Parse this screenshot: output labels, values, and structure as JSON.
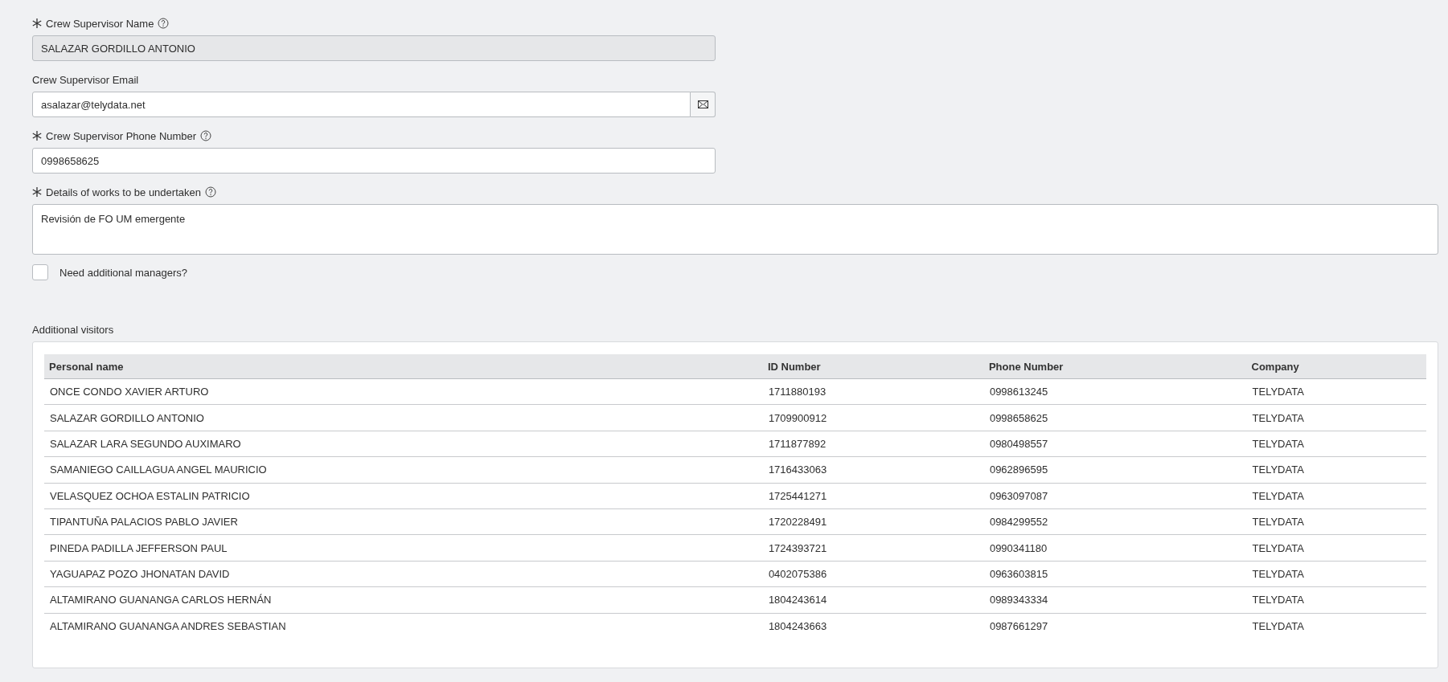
{
  "fields": [
    {
      "kind": "text",
      "label": "Crew Supervisor Name",
      "required": true,
      "help": true,
      "value": "SALAZAR GORDILLO ANTONIO",
      "disabled": true
    },
    {
      "kind": "email",
      "label": "Crew Supervisor Email",
      "required": false,
      "help": false,
      "value": "asalazar@telydata.net",
      "disabled": false
    },
    {
      "kind": "text",
      "label": "Crew Supervisor Phone Number",
      "required": true,
      "help": true,
      "value": "0998658625",
      "disabled": false
    },
    {
      "kind": "textarea",
      "label": "Details of works to be undertaken",
      "required": true,
      "help": true,
      "value": "Revisión de FO UM emergente",
      "disabled": false
    }
  ],
  "checkbox": {
    "label": "Need additional managers?",
    "checked": false
  },
  "visitors": {
    "title": "Additional visitors",
    "columns": [
      "Personal name",
      "ID Number",
      "Phone Number",
      "Company"
    ],
    "rows": [
      [
        "ONCE CONDO XAVIER ARTURO",
        "1711880193",
        "0998613245",
        "TELYDATA"
      ],
      [
        "SALAZAR GORDILLO ANTONIO",
        "1709900912",
        "0998658625",
        "TELYDATA"
      ],
      [
        "SALAZAR LARA SEGUNDO AUXIMARO",
        "1711877892",
        "0980498557",
        "TELYDATA"
      ],
      [
        "SAMANIEGO CAILLAGUA ANGEL MAURICIO",
        "1716433063",
        "0962896595",
        "TELYDATA"
      ],
      [
        "VELASQUEZ OCHOA ESTALIN PATRICIO",
        "1725441271",
        "0963097087",
        "TELYDATA"
      ],
      [
        "TIPANTUÑA PALACIOS PABLO JAVIER",
        "1720228491",
        "0984299552",
        "TELYDATA"
      ],
      [
        "PINEDA PADILLA JEFFERSON PAUL",
        "1724393721",
        "0990341180",
        "TELYDATA"
      ],
      [
        "YAGUAPAZ POZO JHONATAN DAVID",
        "0402075386",
        "0963603815",
        "TELYDATA"
      ],
      [
        "ALTAMIRANO GUANANGA CARLOS HERNÁN",
        "1804243614",
        "0989343334",
        "TELYDATA"
      ],
      [
        "ALTAMIRANO GUANANGA ANDRES SEBASTIAN",
        "1804243663",
        "0987661297",
        "TELYDATA"
      ]
    ]
  }
}
